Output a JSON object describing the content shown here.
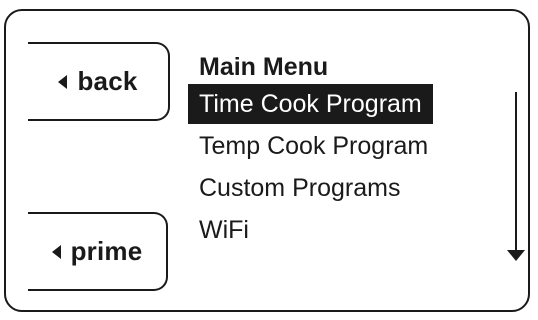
{
  "softkeys": {
    "back": {
      "label": "back",
      "icon": "left-triangle-icon"
    },
    "prime": {
      "label": "prime",
      "icon": "left-triangle-icon"
    }
  },
  "menu": {
    "title": "Main Menu",
    "items": [
      {
        "label": "Time Cook Program",
        "selected": true
      },
      {
        "label": "Temp Cook Program",
        "selected": false
      },
      {
        "label": "Custom Programs",
        "selected": false
      },
      {
        "label": "WiFi",
        "selected": false
      }
    ]
  },
  "scroll": {
    "icon": "down-arrow-icon"
  }
}
